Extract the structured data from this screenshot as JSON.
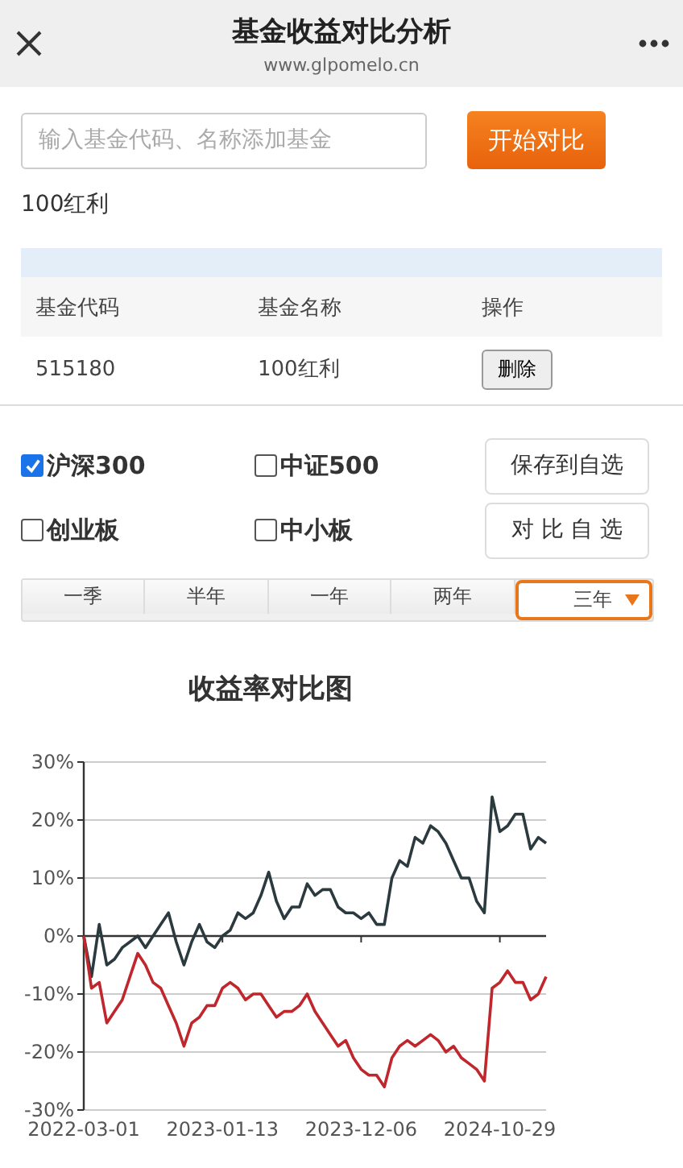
{
  "header": {
    "title": "基金收益对比分析",
    "url": "www.glpomelo.cn"
  },
  "search": {
    "placeholder": "输入基金代码、名称添加基金",
    "button": "开始对比"
  },
  "selected_fund": "100红利",
  "table": {
    "columns": [
      "基金代码",
      "基金名称",
      "操作"
    ],
    "rows": [
      {
        "code": "515180",
        "name": "100红利",
        "action": "删除"
      }
    ]
  },
  "indices": [
    {
      "label": "沪深300",
      "checked": true
    },
    {
      "label": "中证500",
      "checked": false
    },
    {
      "label": "创业板",
      "checked": false
    },
    {
      "label": "中小板",
      "checked": false
    }
  ],
  "buttons": [
    "保存到自选",
    "对 比 自 选"
  ],
  "periods": [
    {
      "label": "一季",
      "selected": false
    },
    {
      "label": "半年",
      "selected": false
    },
    {
      "label": "一年",
      "selected": false
    },
    {
      "label": "两年",
      "selected": false
    },
    {
      "label": "三年",
      "selected": true
    }
  ],
  "chart_data": {
    "type": "line",
    "title": "收益率对比图",
    "categories": [
      "2022-03-01",
      null,
      null,
      null,
      null,
      null,
      null,
      null,
      null,
      null,
      null,
      null,
      null,
      null,
      null,
      null,
      null,
      null,
      "2023-01-13",
      null,
      null,
      null,
      null,
      null,
      null,
      null,
      null,
      null,
      null,
      null,
      null,
      null,
      null,
      null,
      null,
      null,
      "2023-12-06",
      null,
      null,
      null,
      null,
      null,
      null,
      null,
      null,
      null,
      null,
      null,
      null,
      null,
      null,
      null,
      null,
      null,
      "2024-10-29",
      null,
      null,
      null,
      null,
      null,
      null
    ],
    "series": [
      {
        "color": "#2b3a3f",
        "values": [
          0,
          -7,
          2,
          -5,
          -4,
          -2,
          -1,
          0,
          -2,
          0,
          2,
          4,
          -1,
          -5,
          -1,
          2,
          -1,
          -2,
          0,
          1,
          4,
          3,
          4,
          7,
          11,
          6,
          3,
          5,
          5,
          9,
          7,
          8,
          8,
          5,
          4,
          4,
          3,
          4,
          2,
          2,
          10,
          13,
          12,
          17,
          16,
          19,
          18,
          16,
          13,
          10,
          10,
          6,
          4,
          24,
          18,
          19,
          21,
          21,
          15,
          17,
          16
        ]
      },
      {
        "color": "#c0272d",
        "values": [
          0,
          -9,
          -8,
          -15,
          -13,
          -11,
          -7,
          -3,
          -5,
          -8,
          -9,
          -12,
          -15,
          -19,
          -15,
          -14,
          -12,
          -12,
          -9,
          -8,
          -9,
          -11,
          -10,
          -10,
          -12,
          -14,
          -13,
          -13,
          -12,
          -10,
          -13,
          -15,
          -17,
          -19,
          -18,
          -21,
          -23,
          -24,
          -24,
          -26,
          -21,
          -19,
          -18,
          -19,
          -18,
          -17,
          -18,
          -20,
          -19,
          -21,
          -22,
          -23,
          -25,
          -9,
          -8,
          -6,
          -8,
          -8,
          -11,
          -10,
          -7
        ]
      }
    ],
    "ylim": [
      -30,
      30
    ],
    "grid": true,
    "yticks": [
      {
        "value": 30,
        "label": "30%"
      },
      {
        "value": 20,
        "label": "20%"
      },
      {
        "value": 10,
        "label": "10%"
      },
      {
        "value": 0,
        "label": "0%"
      },
      {
        "value": -10,
        "label": "-10%"
      },
      {
        "value": -20,
        "label": "-20%"
      },
      {
        "value": -30,
        "label": "-30%"
      }
    ]
  }
}
